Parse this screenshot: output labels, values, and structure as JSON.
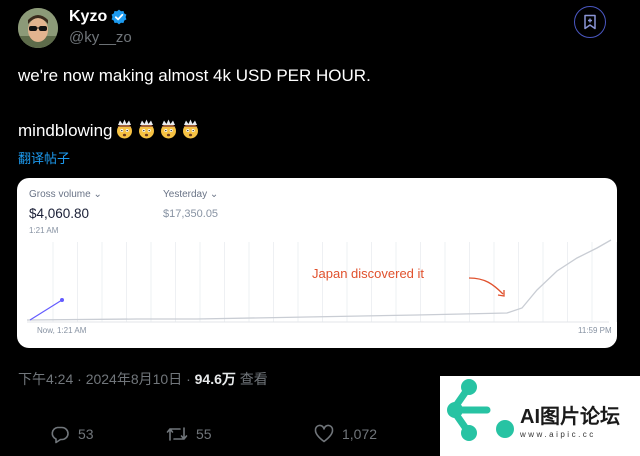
{
  "author": {
    "name": "Kyzo",
    "handle": "@ky__zo"
  },
  "tweet": {
    "line1": "we're now making almost 4k USD PER HOUR.",
    "line2": "mindblowing",
    "emojis": [
      "exploding-head",
      "exploding-head",
      "exploding-head",
      "exploding-head"
    ],
    "translate_link": "翻译帖子"
  },
  "card": {
    "gross_label": "Gross volume",
    "gross_value": "$4,060.80",
    "gross_time": "1:21 AM",
    "yesterday_label": "Yesterday",
    "yesterday_value": "$17,350.05",
    "annotation": "Japan discovered it",
    "x_start": "Now, 1:21 AM",
    "x_end": "11:59 PM",
    "today_color": "#635bff",
    "yesterday_color": "#c9cdd4",
    "annotation_color": "#e0512d"
  },
  "meta": {
    "time_date": "下午4:24 · 2024年8月10日 · ",
    "views": "94.6万",
    "views_label": " 查看"
  },
  "actions": {
    "replies": "53",
    "retweets": "55",
    "likes": "1,072"
  },
  "watermark": {
    "title": "AI图片论坛",
    "url": "www.aipic.cc"
  }
}
